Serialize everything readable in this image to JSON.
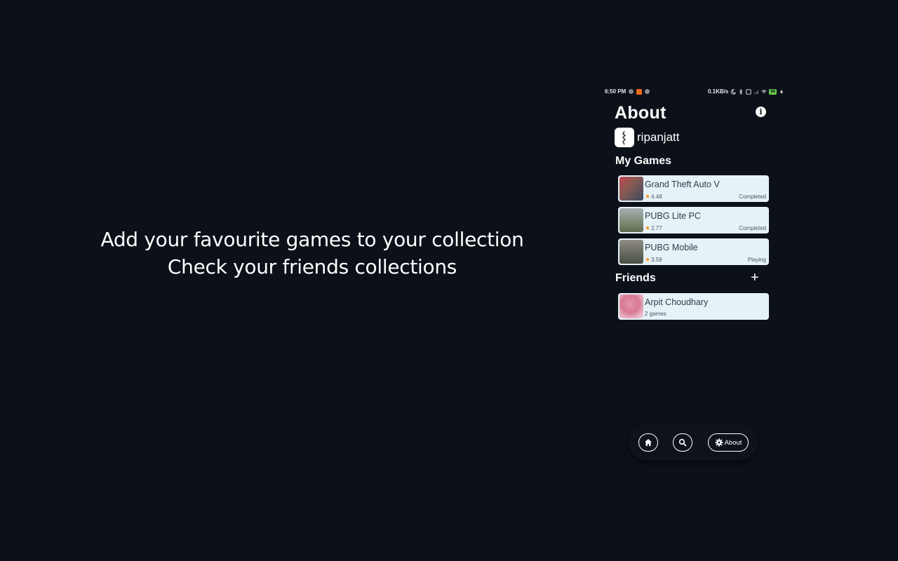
{
  "promo": {
    "line1": "Add your favourite games to your collection",
    "line2": "Check your friends collections"
  },
  "status_bar": {
    "time": "6:50 PM",
    "speed": "0.1KB/s",
    "battery": "88"
  },
  "header": {
    "title": "About",
    "info_icon": "info-icon"
  },
  "user": {
    "username": "ripanjatt"
  },
  "my_games": {
    "heading": "My Games",
    "items": [
      {
        "name": "Grand Theft Auto V",
        "rating": "4.48",
        "status": "Completed",
        "thumb_color": "#8a5a52"
      },
      {
        "name": "PUBG Lite PC",
        "rating": "2.77",
        "status": "Completed",
        "thumb_color": "#7f8d76"
      },
      {
        "name": "PUBG Mobile",
        "rating": "3.59",
        "status": "Playing",
        "thumb_color": "#6a6e62"
      }
    ]
  },
  "friends": {
    "heading": "Friends",
    "add_icon": "plus-icon",
    "items": [
      {
        "name": "Arpit Choudhary",
        "games": "2 games",
        "thumb_color": "#d87a94"
      }
    ]
  },
  "nav": {
    "home_icon": "home-icon",
    "search_icon": "search-icon",
    "about_label": "About",
    "about_icon": "gear-icon"
  },
  "colors": {
    "background": "#0c1018",
    "card": "#e6f1f8",
    "star": "#f29a1b"
  }
}
